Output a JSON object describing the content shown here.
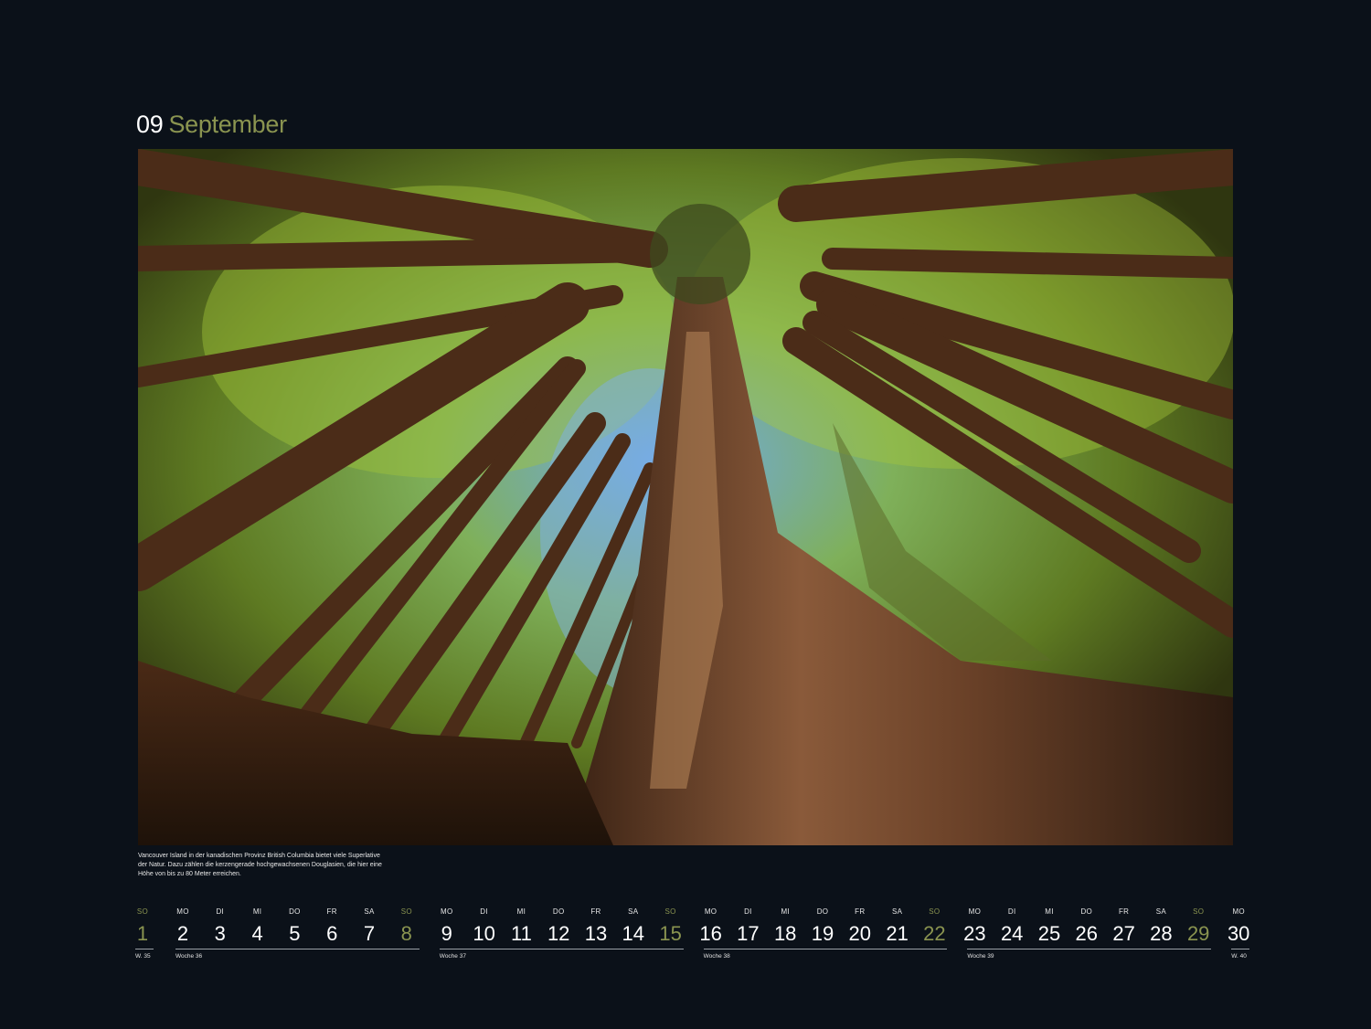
{
  "header": {
    "month_number": "09",
    "month_name": "September"
  },
  "photo": {
    "subject": "forest-canopy-photo"
  },
  "caption": "Vancouver Island in der kanadischen Provinz British Columbia bietet viele Superlative der Natur. Dazu zählen die kerzengerade hochgewachsenen Douglasien, die hier eine Höhe von bis zu 80 Meter erreichen.",
  "colors": {
    "background": "#0b1119",
    "accent": "#8a9450",
    "text": "#ffffff"
  },
  "calendar": {
    "days": [
      {
        "dn": "SO",
        "d": "1",
        "sun": true
      },
      {
        "dn": "MO",
        "d": "2"
      },
      {
        "dn": "DI",
        "d": "3"
      },
      {
        "dn": "MI",
        "d": "4"
      },
      {
        "dn": "DO",
        "d": "5"
      },
      {
        "dn": "FR",
        "d": "6"
      },
      {
        "dn": "SA",
        "d": "7"
      },
      {
        "dn": "SO",
        "d": "8",
        "sun": true
      },
      {
        "dn": "MO",
        "d": "9"
      },
      {
        "dn": "DI",
        "d": "10"
      },
      {
        "dn": "MI",
        "d": "11"
      },
      {
        "dn": "DO",
        "d": "12"
      },
      {
        "dn": "FR",
        "d": "13"
      },
      {
        "dn": "SA",
        "d": "14"
      },
      {
        "dn": "SO",
        "d": "15",
        "sun": true
      },
      {
        "dn": "MO",
        "d": "16"
      },
      {
        "dn": "DI",
        "d": "17"
      },
      {
        "dn": "MI",
        "d": "18"
      },
      {
        "dn": "DO",
        "d": "19"
      },
      {
        "dn": "FR",
        "d": "20"
      },
      {
        "dn": "SA",
        "d": "21"
      },
      {
        "dn": "SO",
        "d": "22",
        "sun": true
      },
      {
        "dn": "MO",
        "d": "23"
      },
      {
        "dn": "DI",
        "d": "24"
      },
      {
        "dn": "MI",
        "d": "25"
      },
      {
        "dn": "DO",
        "d": "26"
      },
      {
        "dn": "FR",
        "d": "27"
      },
      {
        "dn": "SA",
        "d": "28"
      },
      {
        "dn": "SO",
        "d": "29",
        "sun": true
      },
      {
        "dn": "MO",
        "d": "30"
      }
    ],
    "weeks": [
      "W. 35",
      "Woche 36",
      "Woche 37",
      "Woche 38",
      "Woche 39",
      "W. 40"
    ]
  }
}
